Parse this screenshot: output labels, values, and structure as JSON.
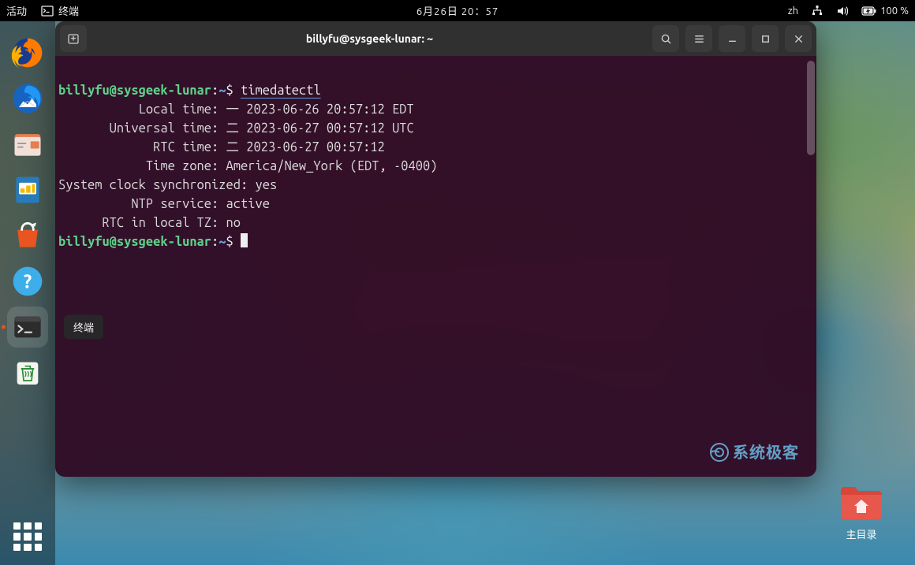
{
  "topbar": {
    "activities": "活动",
    "app_name": "终端",
    "datetime": "6月26日 20：57",
    "input_method": "zh",
    "battery": "100 %"
  },
  "dock": {
    "tooltip_terminal": "终端"
  },
  "desktop": {
    "home_label": "主目录"
  },
  "terminal": {
    "title": "billyfu@sysgeek-lunar: ~",
    "prompt_user": "billyfu@sysgeek-lunar",
    "prompt_path": "~",
    "prompt_symbol": "$",
    "command": "timedatectl",
    "output": {
      "local_time_label": "           Local time:",
      "local_time_value": "一 2023-06-26 20:57:12 EDT",
      "universal_time_label": "       Universal time:",
      "universal_time_value": "二 2023-06-27 00:57:12 UTC",
      "rtc_time_label": "             RTC time:",
      "rtc_time_value": "二 2023-06-27 00:57:12",
      "timezone_label": "            Time zone:",
      "timezone_value": "America/New_York (EDT, -0400)",
      "sync_label": "System clock synchronized:",
      "sync_value": "yes",
      "ntp_label": "          NTP service:",
      "ntp_value": "active",
      "rtc_local_label": "      RTC in local TZ:",
      "rtc_local_value": "no"
    },
    "watermark": "系统极客"
  }
}
